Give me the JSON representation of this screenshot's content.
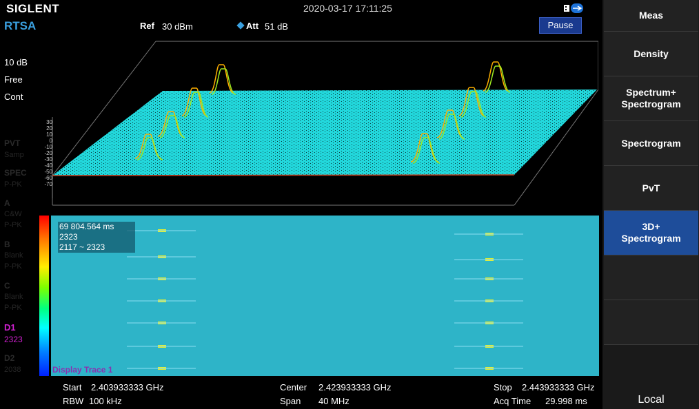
{
  "header": {
    "brand": "SIGLENT",
    "datetime": "2020-03-17 17:11:25",
    "mode": "RTSA",
    "ref_label": "Ref",
    "ref_value": "30 dBm",
    "att_label": "Att",
    "att_value": "51 dB",
    "pause_label": "Pause"
  },
  "left_panel": {
    "scale": "10 dB",
    "trigger": "Free",
    "sweep": "Cont",
    "pvt_label": "PVT",
    "pvt_mode": "Samp",
    "spec_label": "SPEC",
    "spec_mode": "P-PK",
    "trace_a": "A",
    "trace_a_type": "C&W",
    "trace_a_mode": "P-PK",
    "trace_b": "B",
    "trace_b_type": "Blank",
    "trace_b_mode": "P-PK",
    "trace_c": "C",
    "trace_c_type": "Blank",
    "trace_c_mode": "P-PK",
    "d1_label": "D1",
    "d1_value": "2323",
    "d2_label": "D2",
    "d2_value": "2038"
  },
  "axis": {
    "y_ticks": [
      "30",
      "20",
      "10",
      "0",
      "-10",
      "-20",
      "-30",
      "-40",
      "-50",
      "-60",
      "-70"
    ]
  },
  "spectrogram": {
    "marker_time": "69 804.564 ms",
    "marker_trace": "2323",
    "marker_range": "2117 ~ 2323",
    "display_trace": "Display Trace 1"
  },
  "footer": {
    "start_label": "Start",
    "start_value": "2.403933333 GHz",
    "center_label": "Center",
    "center_value": "2.423933333 GHz",
    "stop_label": "Stop",
    "stop_value": "2.443933333 GHz",
    "rbw_label": "RBW",
    "rbw_value": "100 kHz",
    "span_label": "Span",
    "span_value": "40 MHz",
    "acq_label": "Acq Time",
    "acq_value": "29.998 ms"
  },
  "softkeys": [
    {
      "label": "Meas"
    },
    {
      "label": "Density"
    },
    {
      "label": "Spectrum+\nSpectrogram"
    },
    {
      "label": "Spectrogram"
    },
    {
      "label": "PvT"
    },
    {
      "label": "3D+\nSpectrogram"
    },
    {
      "label": ""
    },
    {
      "label": ""
    }
  ],
  "status": {
    "local": "Local"
  },
  "colors": {
    "accent": "#3aa0e0",
    "active_key": "#1e4d9a",
    "spectrogram_bg": "#2eb4c8",
    "d1_magenta": "#d020d0"
  }
}
